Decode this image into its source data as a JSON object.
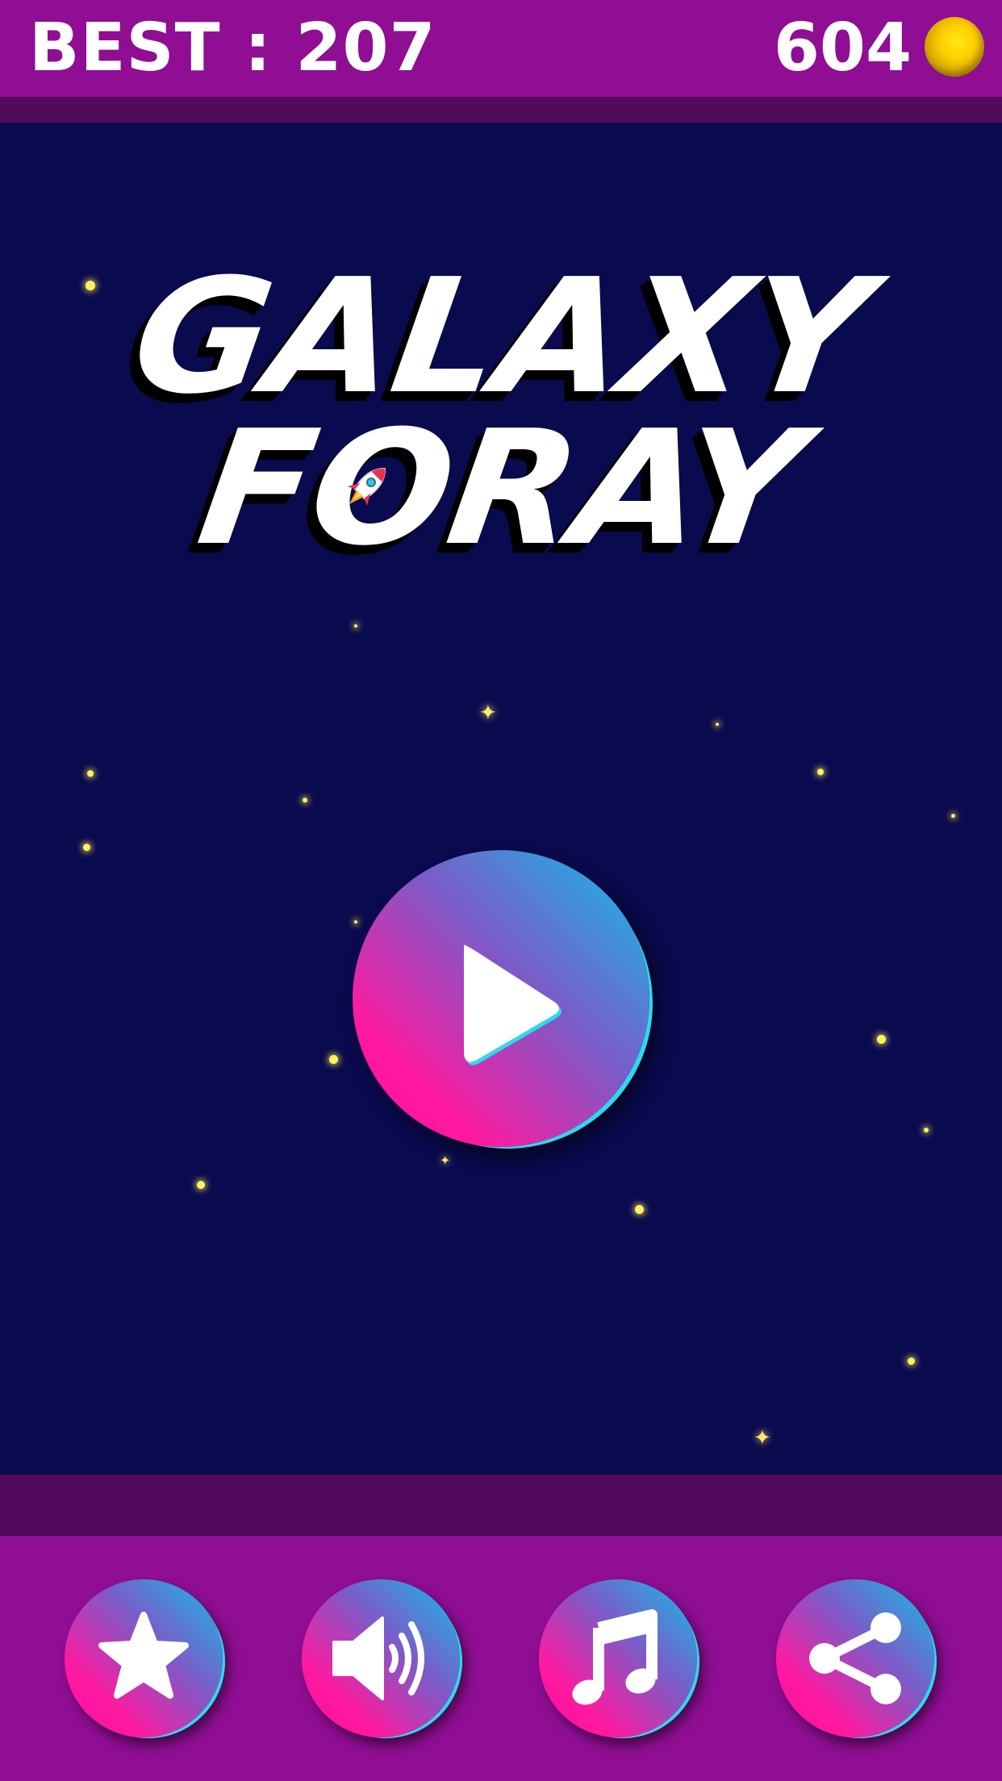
{
  "header": {
    "best_label": "BEST : 207",
    "coins": "604",
    "coin_icon": "gold-coin-icon"
  },
  "title": {
    "line1": "GALAXY",
    "line2": "FORAY"
  },
  "buttons": {
    "play": "play-icon",
    "leaderboard": "star-icon",
    "sound": "speaker-icon",
    "music": "music-note-icon",
    "share": "share-icon"
  },
  "colors": {
    "bar": "#8f0e93",
    "bar_shade": "#520a5c",
    "space": "#0a0a4e",
    "button_pink": "#ff0aa0",
    "button_cyan": "#10c0e8",
    "star": "#fff35a"
  }
}
